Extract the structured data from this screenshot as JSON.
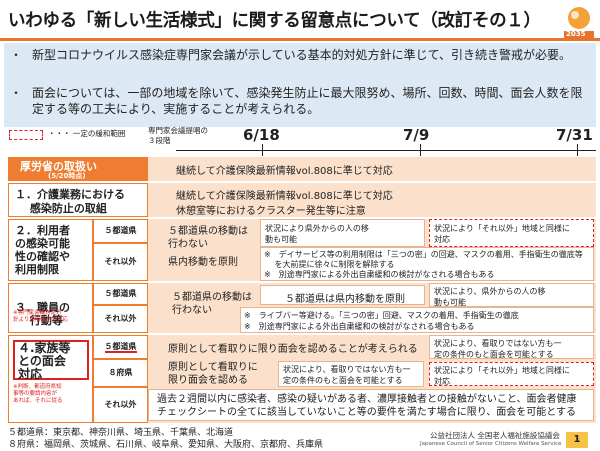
{
  "title": "いわゆる「新しい生活様式」に関する留意点について（改訂その１）",
  "logo": {
    "tag": "2035"
  },
  "bullets": [
    {
      "marker": "・",
      "text": "新型コロナウイルス感染症専門家会議が示している基本的対処方針に準じて、引き続き警戒が必要。"
    },
    {
      "marker": "・",
      "text": "面会については、一部の地域を除いて、感染発生防止に最大限努め、場所、回数、時間、面会人数を限定する等の工夫により、実施することが考えられる。"
    }
  ],
  "legend": {
    "text": "・・・ 一定の緩和範囲"
  },
  "expert_note": "専門家会議提唱の\n３段階",
  "dates": [
    "6/18",
    "7/9",
    "7/31"
  ],
  "header": {
    "title": "厚労省の取扱い",
    "sub": "(5/20時点)",
    "text": "継続して介護保険最新情報vol.808に準じて対応"
  },
  "sections": {
    "s1": {
      "label": "１．介護業務における\n　 感染防止の取組",
      "lines": [
        "継続して介護保険最新情報vol.808に準じて対応",
        "休憩室等におけるクラスター発生等に注意"
      ]
    },
    "s2": {
      "label": "２．利用者\nの感染可能\n性の確認や\n利用制限",
      "sub_a": "５都道県",
      "sub_b": "それ以外",
      "a_text": "５都道県の移動は\n行わない",
      "b_text": "県内移動を原則",
      "box1": "状況により県外からの人の移\n動も可能",
      "box2": "状況により「それ以外」地域と同様に\n対応",
      "notes": [
        "※　デイサービス等の利用制限は「三つの密」の回避、マスクの着用、手指衛生の徹底等",
        "　 を大前提に徐々に制限を解除する",
        "※　別途専門家による外出自粛緩和の検討がなされる場合もある"
      ]
    },
    "s3": {
      "label": "３．職員の\n　 行動等",
      "note": "※専門家会議対処方\n針より段階適当で対応",
      "sub_a": "５都道県",
      "sub_b": "それ以外",
      "a_text": "５都道県の移動は\n行わない",
      "b_mid": "５都道県は県内移動を原則",
      "b_box": "状況により、県外からの人の移\n動も可能",
      "box_right": "状況により、県外からの人の移\n動も可能",
      "notes": [
        "※　ライブバー等避ける。「三つの密」回避、マスクの着用、手指衛生の徹底",
        "※　別途専門家による外出自粛緩和の検討がなされる場合もある"
      ]
    },
    "s4": {
      "label": "４.家族等\nとの面会\n対応",
      "note": "※判断、都道府県知\n事等の要請内容が\nあれば、それに従る",
      "sub_a": "５都道県",
      "sub_b": "８府県",
      "sub_c": "それ以外",
      "a_text": "原則として看取りに限り面会を認めることが考えられる",
      "a_box": "状況により、看取りではない方も一\n定の条件のもと面会を可能とする",
      "b_text": "原則として看取りに\n限り面会を認める",
      "b_box": "状況により、看取りではない方も一\n定の条件のもと面会を可能とする",
      "b_right": "状況により「それ以外」地域と同様に\n対応",
      "c_text": "過去２週間以内に感染者、感染の疑いがある者、濃厚接触者との接触がないこと、面会者健康\nチェックシートの全てに該当していないこと等の要件を満たす場合に限り、面会を可能とする"
    }
  },
  "footnotes": [
    "５都道県：東京都、神奈川県、埼玉県、千葉県、北海道",
    "８府県：福岡県、茨城県、石川県、岐阜県、愛知県、大阪府、京都府、兵庫県"
  ],
  "footer": {
    "org": "公益社団法人 全国老人福祉施設協議会",
    "org_en": "Japanese Council of Senior Citizens Welfare Service",
    "page": "1"
  },
  "colors": {
    "accent": "#ee7d31",
    "peach": "#fbe1cc",
    "bullet_bg": "#dce8f4",
    "highlight": "#e02020"
  }
}
